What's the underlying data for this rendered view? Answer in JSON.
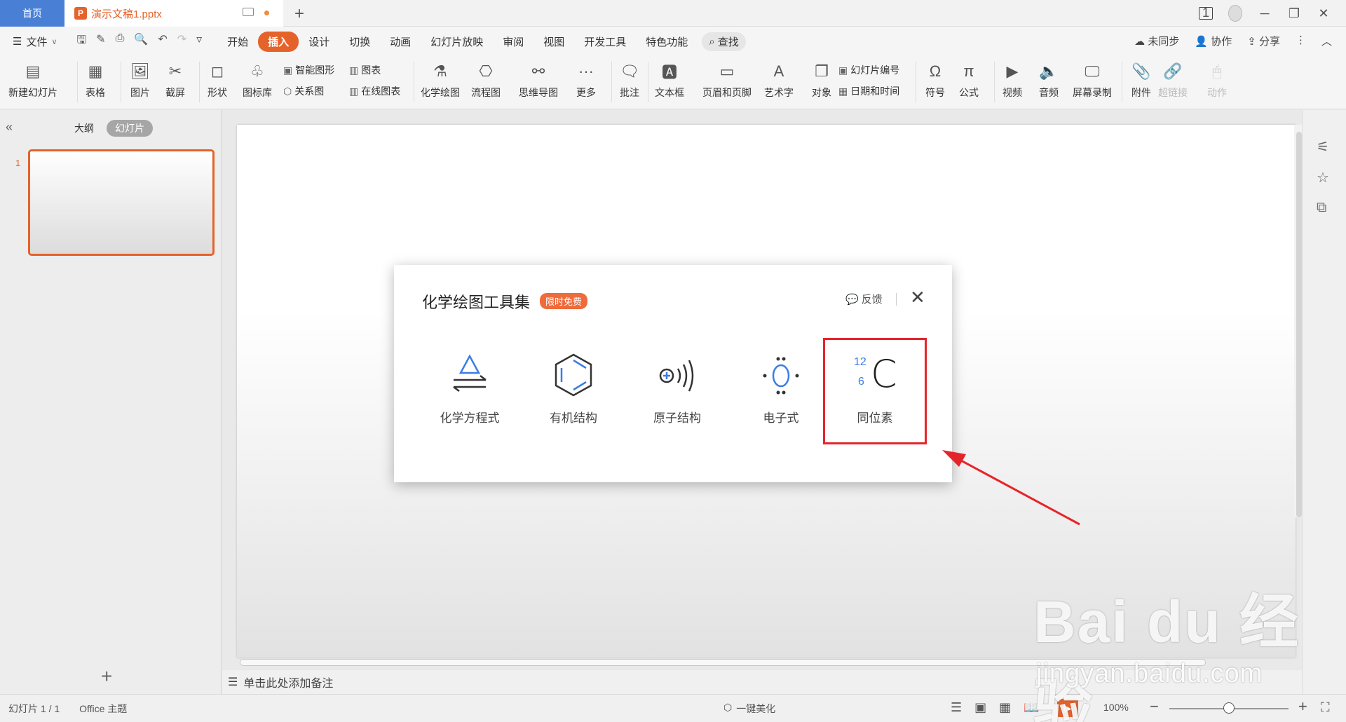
{
  "titlebar": {
    "home_tab": "首页",
    "doc_tab": "演示文稿1.pptx",
    "doc_icon": "P",
    "add_tab": "+",
    "page_badge": "1"
  },
  "menubar": {
    "file": "文件",
    "items": [
      "开始",
      "插入",
      "设计",
      "切换",
      "动画",
      "幻灯片放映",
      "审阅",
      "视图",
      "开发工具",
      "特色功能"
    ],
    "active_item": "插入",
    "search": "查找",
    "sync": "未同步",
    "collab": "协作",
    "share": "分享"
  },
  "ribbon": {
    "new_slide": "新建幻灯片",
    "table": "表格",
    "picture": "图片",
    "screenshot": "截屏",
    "shape": "形状",
    "icon_lib": "图标库",
    "smart_shape": "智能图形",
    "relation": "关系图",
    "chart": "图表",
    "online_chart": "在线图表",
    "chem_draw": "化学绘图",
    "flowchart": "流程图",
    "mindmap": "思维导图",
    "more": "更多",
    "comment": "批注",
    "textbox": "文本框",
    "header_footer": "页眉和页脚",
    "wordart": "艺术字",
    "object": "对象",
    "slide_number": "幻灯片编号",
    "datetime": "日期和时间",
    "symbol": "符号",
    "formula": "公式",
    "video": "视频",
    "audio": "音频",
    "screen_record": "屏幕录制",
    "attachment": "附件",
    "hyperlink": "超链接",
    "action": "动作"
  },
  "leftpane": {
    "outline_tab": "大纲",
    "slides_tab": "幻灯片",
    "slide_number": "1",
    "add": "+"
  },
  "notes": {
    "placeholder": "单击此处添加备注"
  },
  "status": {
    "slide_info": "幻灯片 1 / 1",
    "theme": "Office 主题",
    "beautify": "一键美化",
    "zoom": "100%"
  },
  "dialog": {
    "title": "化学绘图工具集",
    "badge": "限时免费",
    "feedback": "反馈",
    "tools": [
      {
        "label": "化学方程式",
        "icon": "equation-icon"
      },
      {
        "label": "有机结构",
        "icon": "benzene-icon"
      },
      {
        "label": "原子结构",
        "icon": "atom-icon"
      },
      {
        "label": "电子式",
        "icon": "electron-icon"
      },
      {
        "label": "同位素",
        "icon": "isotope-icon"
      }
    ],
    "isotope_mass": "12",
    "isotope_number": "6",
    "isotope_symbol": "C"
  },
  "watermark": {
    "line1": "Bai du 经验",
    "line2": "jingyan.baidu.com"
  },
  "colors": {
    "accent": "#e5622a",
    "tab_blue": "#4a7fd6",
    "highlight": "#e5242a",
    "icon_blue": "#3b7de6"
  }
}
